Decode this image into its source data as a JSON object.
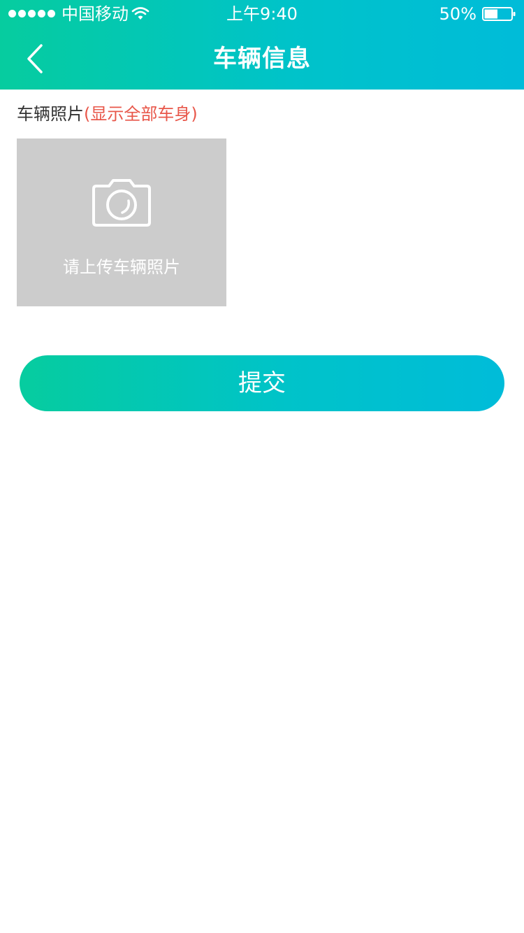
{
  "status_bar": {
    "carrier": "中国移动",
    "time": "上午9:40",
    "battery": "50%",
    "battery_level": 0.5,
    "signal_dots": 5,
    "wifi_icon": "wifi-icon",
    "battery_icon": "battery-icon"
  },
  "nav": {
    "back_icon": "chevron-left-icon",
    "title": "车辆信息"
  },
  "photo_section": {
    "label": "车辆照片",
    "hint": "(显示全部车身)",
    "upload_icon": "camera-icon",
    "upload_text": "请上传车辆照片"
  },
  "submit": {
    "label": "提交"
  },
  "colors": {
    "gradient_start": "#06cc9f",
    "gradient_end": "#00bcd9",
    "hint_red": "#e8574a",
    "upload_bg": "#cccccc",
    "label_text": "#333333"
  }
}
